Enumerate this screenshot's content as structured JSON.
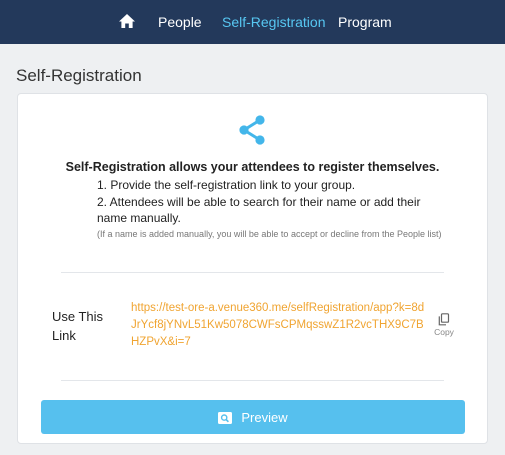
{
  "nav": {
    "home_icon": "home-icon",
    "items": [
      {
        "label": "People",
        "active": false
      },
      {
        "label": "Self-Registration",
        "active": true
      },
      {
        "label": "Program",
        "active": false
      }
    ],
    "colors": {
      "bar": "#23395b",
      "active": "#57c7f2",
      "text": "#ffffff"
    }
  },
  "page": {
    "title": "Self-Registration"
  },
  "card": {
    "icon": "share-icon",
    "headline": "Self-Registration allows your attendees to register themselves.",
    "step1": "1. Provide the self-registration link to your group.",
    "step2": "2. Attendees will be able to search for their name or add their name manually.",
    "note": "(If a name is added manually, you will be able to accept or decline from the People list)",
    "link_label": "Use This Link",
    "link_url": "https://test-ore-a.venue360.me/selfRegistration/app?k=8dJrYcf8jYNvL51Kw5078CWFsCPMqsswZ1R2vcTHX9C7BHZPvX&i=7",
    "copy_label": "Copy",
    "copy_icon": "copy-icon",
    "preview_icon": "preview-icon",
    "preview_label": "Preview",
    "colors": {
      "link": "#f0a431",
      "button": "#56c0ee",
      "icon": "#43b6ea"
    }
  }
}
